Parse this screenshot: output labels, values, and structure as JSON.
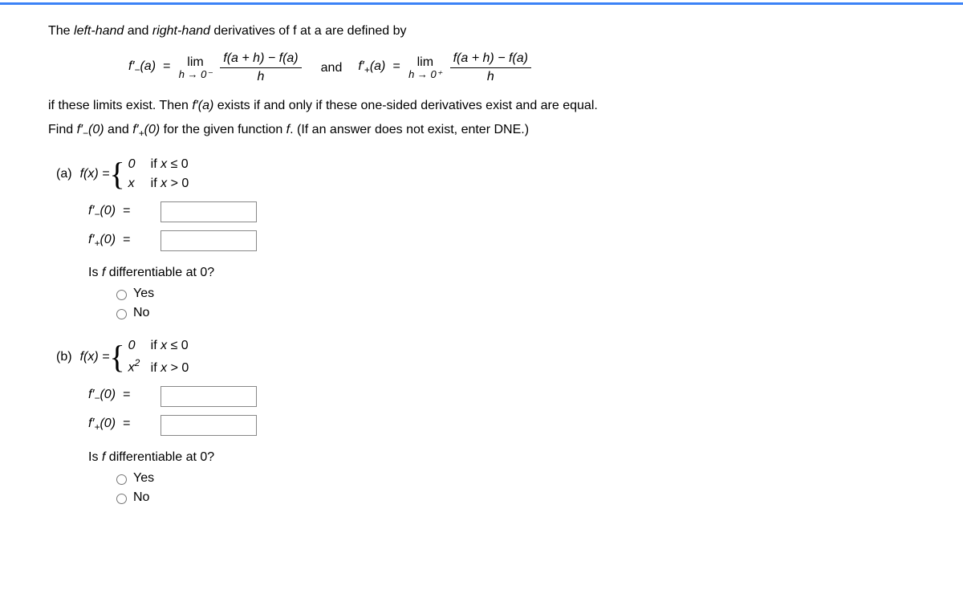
{
  "intro": {
    "prefix": "The ",
    "left_hand": "left-hand",
    "and1": " and ",
    "right_hand": "right-hand",
    "suffix": " derivatives of f at a are defined by"
  },
  "formula": {
    "left_label": "f′_(a) = ",
    "lim": "lim",
    "lim_left_under": "h → 0⁻",
    "numerator": "f(a + h) − f(a)",
    "denominator": "h",
    "and": "and",
    "right_label": "f′₊(a) = ",
    "lim_right_under": "h → 0⁺"
  },
  "para1_a": "if these limits exist. Then ",
  "para1_b": "f′(a)",
  "para1_c": " exists if and only if these one-sided derivatives exist and are equal.",
  "para2_a": "Find ",
  "para2_b": "f′_(0)",
  "para2_c": " and ",
  "para2_d": "f′₊(0)",
  "para2_e": " for the given function ",
  "para2_f": "f",
  "para2_g": ". (If an answer does not exist, enter DNE.)",
  "part_a": {
    "label": "(a)",
    "func_lead": "f(x) = ",
    "case1_val": "0",
    "case1_cond": "if x ≤ 0",
    "case2_val": "x",
    "case2_cond": "if x > 0",
    "ans1_label": "f′_(0)  =",
    "ans2_label": "f′₊(0)  =",
    "question": "Is f differentiable at 0?",
    "yes": "Yes",
    "no": "No"
  },
  "part_b": {
    "label": "(b)",
    "func_lead": "f(x) = ",
    "case1_val": "0",
    "case1_cond": "if x ≤ 0",
    "case2_val": "x²",
    "case2_cond": "if x > 0",
    "ans1_label": "f′_(0)  =",
    "ans2_label": "f′₊(0)  =",
    "question": "Is f differentiable at 0?",
    "yes": "Yes",
    "no": "No"
  }
}
